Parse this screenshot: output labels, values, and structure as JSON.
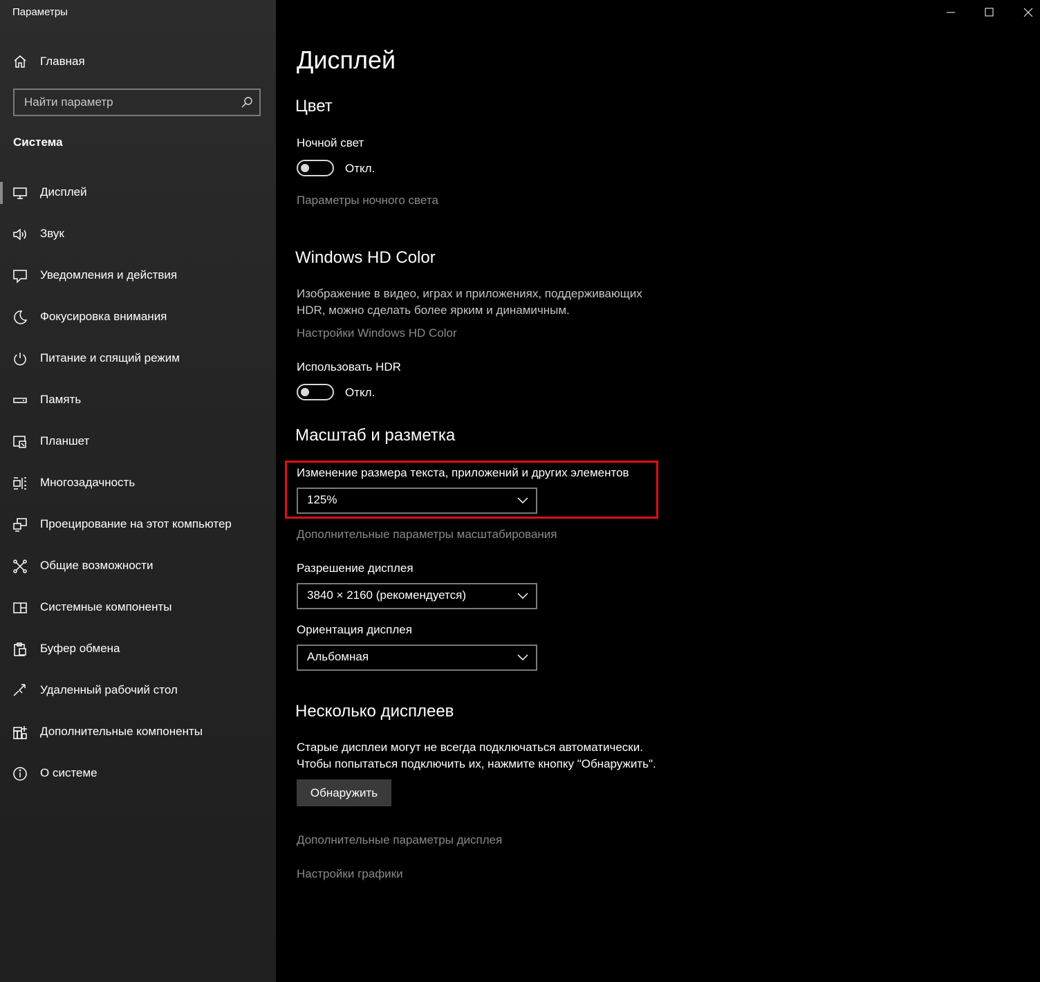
{
  "window": {
    "title": "Параметры",
    "controls": {
      "minimize": "minimize-icon",
      "maximize": "maximize-icon",
      "close": "close-icon"
    }
  },
  "sidebar": {
    "home": {
      "label": "Главная",
      "icon": "home-icon"
    },
    "search": {
      "placeholder": "Найти параметр",
      "value": "",
      "icon": "search-icon"
    },
    "section": "Система",
    "items": [
      {
        "label": "Дисплей",
        "icon": "monitor-icon",
        "active": true
      },
      {
        "label": "Звук",
        "icon": "speaker-icon"
      },
      {
        "label": "Уведомления и действия",
        "icon": "notification-icon"
      },
      {
        "label": "Фокусировка внимания",
        "icon": "moon-icon"
      },
      {
        "label": "Питание и спящий режим",
        "icon": "power-icon"
      },
      {
        "label": "Память",
        "icon": "storage-icon"
      },
      {
        "label": "Планшет",
        "icon": "tablet-icon"
      },
      {
        "label": "Многозадачность",
        "icon": "multitasking-icon"
      },
      {
        "label": "Проецирование на этот компьютер",
        "icon": "projecting-icon"
      },
      {
        "label": "Общие возможности",
        "icon": "shared-experiences-icon"
      },
      {
        "label": "Системные компоненты",
        "icon": "system-components-icon"
      },
      {
        "label": "Буфер обмена",
        "icon": "clipboard-icon"
      },
      {
        "label": "Удаленный рабочий стол",
        "icon": "remote-desktop-icon"
      },
      {
        "label": "Дополнительные компоненты",
        "icon": "optional-features-icon"
      },
      {
        "label": "О системе",
        "icon": "info-icon"
      }
    ]
  },
  "main": {
    "title": "Дисплей",
    "color": {
      "heading": "Цвет",
      "night_light_label": "Ночной свет",
      "night_light_state": "Откл.",
      "night_light_on": false,
      "night_light_settings_link": "Параметры ночного света"
    },
    "hdr": {
      "heading": "Windows HD Color",
      "description_line1": "Изображение в видео, играх и приложениях, поддерживающих",
      "description_line2": "HDR, можно сделать более ярким и динамичным.",
      "settings_link": "Настройки Windows HD Color",
      "use_hdr_label": "Использовать HDR",
      "use_hdr_state": "Откл.",
      "use_hdr_on": false
    },
    "scale": {
      "heading": "Масштаб и разметка",
      "scale_label": "Изменение размера текста, приложений и других элементов",
      "scale_value": "125%",
      "advanced_scaling_link": "Дополнительные параметры масштабирования",
      "resolution_label": "Разрешение дисплея",
      "resolution_value": "3840 × 2160 (рекомендуется)",
      "orientation_label": "Ориентация дисплея",
      "orientation_value": "Альбомная",
      "highlight_color": "#e01010"
    },
    "multiple": {
      "heading": "Несколько дисплеев",
      "description_line1": "Старые дисплеи могут не всегда подключаться автоматически.",
      "description_line2": "Чтобы попытаться подключить их, нажмите кнопку \"Обнаружить\".",
      "detect_button": "Обнаружить",
      "advanced_display_link": "Дополнительные параметры дисплея",
      "graphics_link": "Настройки графики"
    }
  }
}
